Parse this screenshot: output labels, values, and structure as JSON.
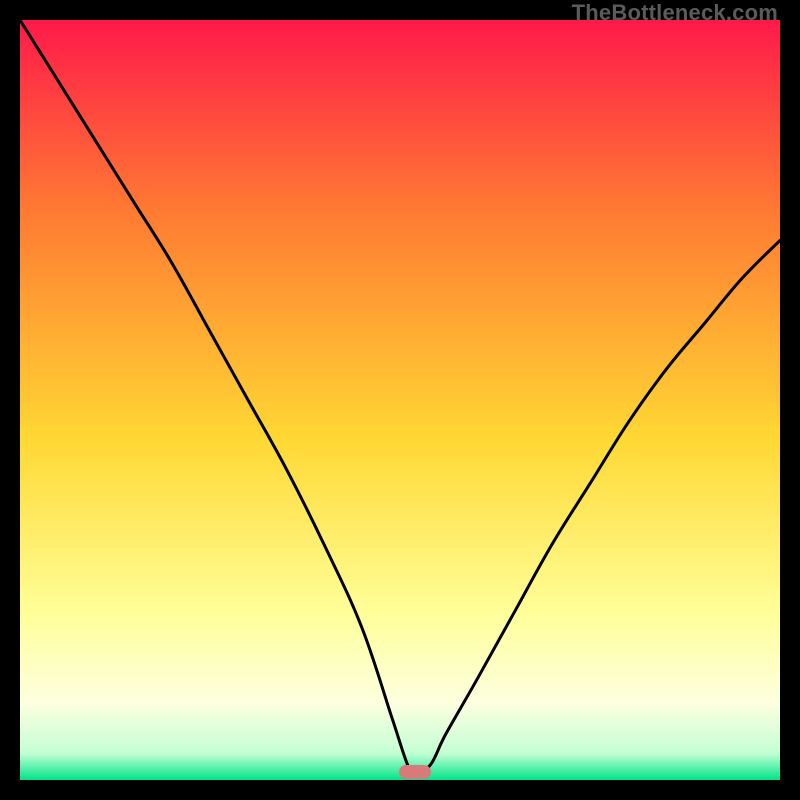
{
  "watermark": "TheBottleneck.com",
  "colors": {
    "top": "#ff1a4a",
    "mid_upper": "#ff7a33",
    "mid": "#ffd833",
    "pale": "#ffff99",
    "cream": "#fdffe0",
    "green": "#00e58a",
    "marker": "#d97a7a",
    "curve": "#000000",
    "frame": "#000000"
  },
  "chart_data": {
    "type": "line",
    "title": "",
    "xlabel": "",
    "ylabel": "",
    "xlim": [
      0,
      100
    ],
    "ylim": [
      0,
      100
    ],
    "grid": false,
    "legend": false,
    "marker": {
      "x": 52,
      "y": 1
    },
    "series": [
      {
        "name": "bottleneck-curve",
        "x": [
          0,
          5,
          10,
          15,
          20,
          25,
          30,
          35,
          40,
          45,
          49,
          51,
          52,
          54,
          56,
          60,
          65,
          70,
          75,
          80,
          85,
          90,
          95,
          100
        ],
        "y": [
          100,
          92,
          84,
          76,
          68,
          59,
          50,
          41,
          31,
          20,
          8,
          2,
          1,
          2,
          6,
          13,
          22,
          31,
          39,
          47,
          54,
          60,
          66,
          71
        ]
      }
    ],
    "background_gradient_stops": [
      {
        "pos": 0.0,
        "color": "#ff1a4a"
      },
      {
        "pos": 0.25,
        "color": "#ff7a33"
      },
      {
        "pos": 0.55,
        "color": "#ffd833"
      },
      {
        "pos": 0.78,
        "color": "#ffff99"
      },
      {
        "pos": 0.9,
        "color": "#fdffe0"
      },
      {
        "pos": 0.965,
        "color": "#c4ffd4"
      },
      {
        "pos": 1.0,
        "color": "#00e58a"
      }
    ]
  }
}
